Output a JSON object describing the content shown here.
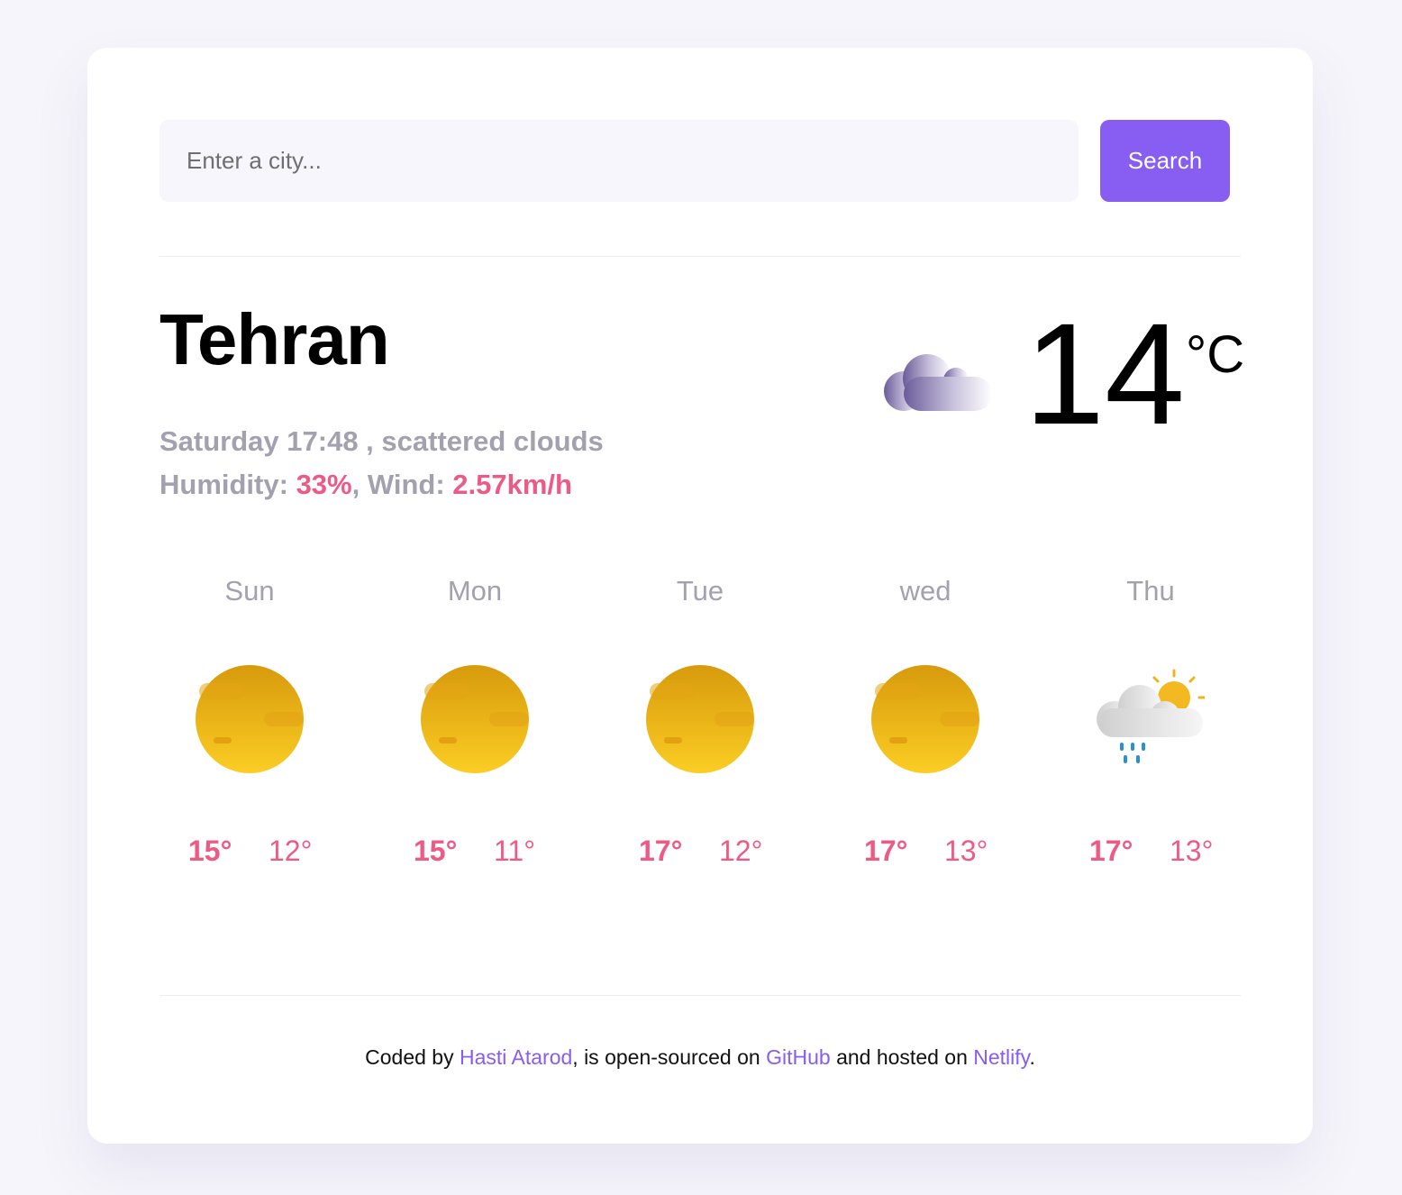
{
  "search": {
    "placeholder": "Enter a city...",
    "button_label": "Search"
  },
  "current": {
    "city": "Tehran",
    "day_time": "Saturday 17:48",
    "description": "scattered clouds",
    "humidity_label": "Humidity:",
    "humidity_value": "33%",
    "wind_label": "Wind:",
    "wind_value": "2.57km/h",
    "temperature": "14",
    "unit": "°C",
    "icon": "scattered-clouds-icon"
  },
  "forecast": [
    {
      "day": "Sun",
      "max": "15°",
      "min": "12°",
      "icon": "sun-icon"
    },
    {
      "day": "Mon",
      "max": "15°",
      "min": "11°",
      "icon": "sun-icon"
    },
    {
      "day": "Tue",
      "max": "17°",
      "min": "12°",
      "icon": "sun-icon"
    },
    {
      "day": "wed",
      "max": "17°",
      "min": "13°",
      "icon": "sun-icon"
    },
    {
      "day": "Thu",
      "max": "17°",
      "min": "13°",
      "icon": "rain-sun-cloud-icon"
    }
  ],
  "footer": {
    "prefix": "Coded by",
    "author": "Hasti Atarod",
    "middle": ", is open-sourced on",
    "github": "GitHub",
    "and_hosted": "and hosted on",
    "netlify": "Netlify",
    "suffix": "."
  },
  "colors": {
    "accent": "#885df1",
    "highlight": "#ee5a86",
    "muted": "#a3a1af",
    "background": "#f6f5fb"
  }
}
